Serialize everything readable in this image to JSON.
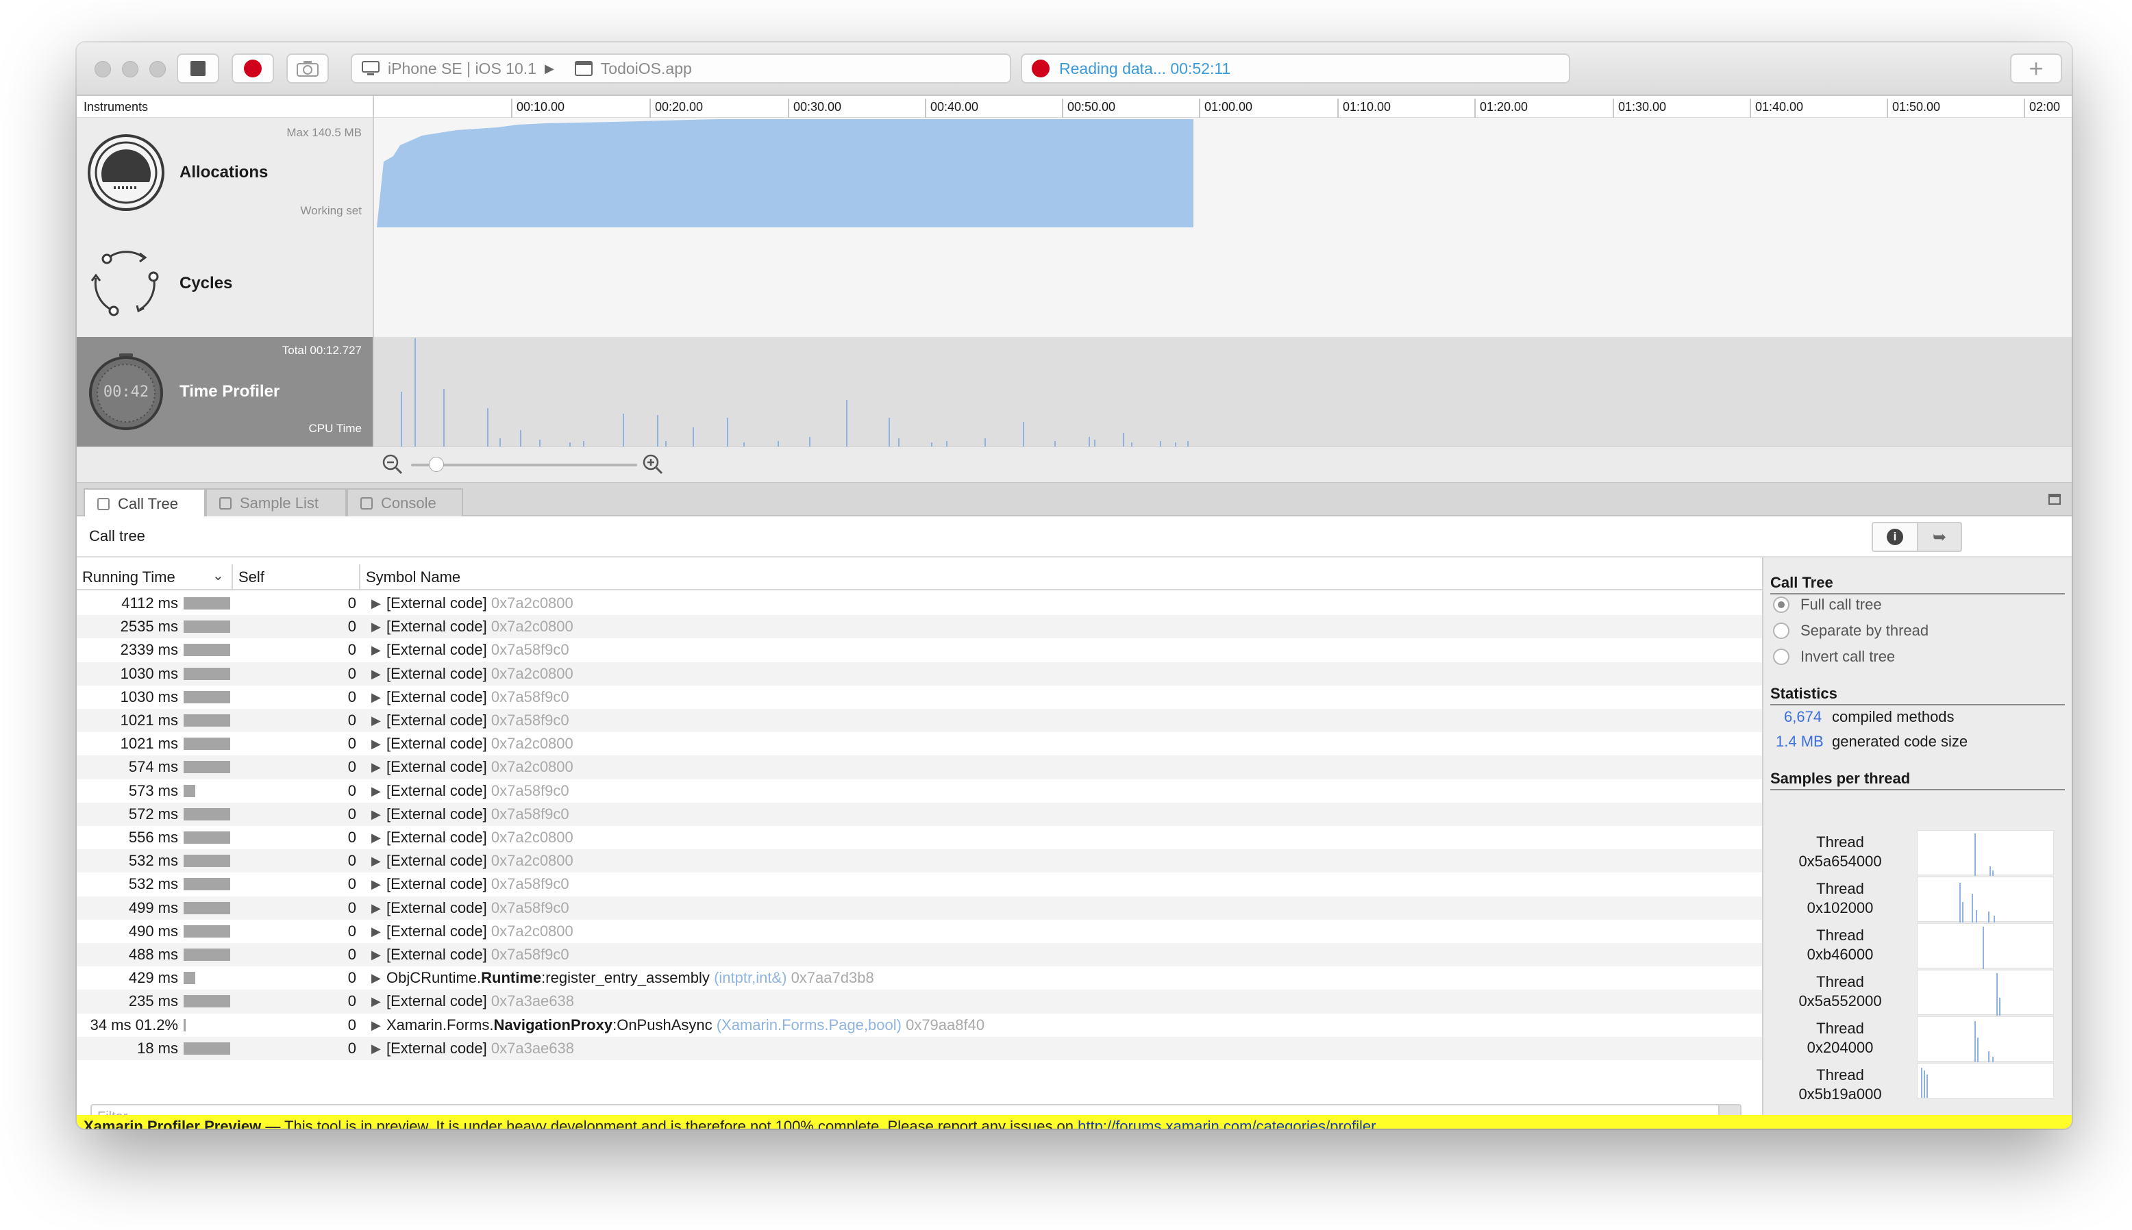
{
  "toolbar": {
    "device_label": "iPhone SE | iOS 10.1",
    "app_label": "TodoiOS.app",
    "status_text": "Reading data... 00:52:11",
    "add_label": "+"
  },
  "instruments": {
    "header": "Instruments",
    "timeline_ticks": [
      "00:10.00",
      "00:20.00",
      "00:30.00",
      "00:40.00",
      "00:50.00",
      "01:00.00",
      "01:10.00",
      "01:20.00",
      "01:30.00",
      "01:40.00",
      "01:50.00",
      "02:00"
    ],
    "tracks": [
      {
        "name": "Allocations",
        "top_text": "Max 140.5 MB",
        "bottom_text": "Working set"
      },
      {
        "name": "Cycles",
        "top_text": "",
        "bottom_text": ""
      },
      {
        "name": "Time Profiler",
        "top_text": "Total 00:12.727",
        "bottom_text": "CPU Time",
        "clock_text": "00:42"
      }
    ]
  },
  "tabs": [
    {
      "label": "Call Tree",
      "active": true
    },
    {
      "label": "Sample List",
      "active": false
    },
    {
      "label": "Console",
      "active": false
    }
  ],
  "calltree": {
    "title": "Call tree",
    "columns": {
      "running_time": "Running Time",
      "self": "Self",
      "symbol": "Symbol Name"
    },
    "rows": [
      {
        "time": "4112 ms",
        "bar": 1.0,
        "self": "0",
        "symbol": "[External code]",
        "addr": "0x7a2c0800"
      },
      {
        "time": "2535 ms",
        "bar": 1.0,
        "self": "0",
        "symbol": "[External code]",
        "addr": "0x7a2c0800"
      },
      {
        "time": "2339 ms",
        "bar": 1.0,
        "self": "0",
        "symbol": "[External code]",
        "addr": "0x7a58f9c0"
      },
      {
        "time": "1030 ms",
        "bar": 1.0,
        "self": "0",
        "symbol": "[External code]",
        "addr": "0x7a2c0800"
      },
      {
        "time": "1030 ms",
        "bar": 1.0,
        "self": "0",
        "symbol": "[External code]",
        "addr": "0x7a58f9c0"
      },
      {
        "time": "1021 ms",
        "bar": 1.0,
        "self": "0",
        "symbol": "[External code]",
        "addr": "0x7a58f9c0"
      },
      {
        "time": "1021 ms",
        "bar": 1.0,
        "self": "0",
        "symbol": "[External code]",
        "addr": "0x7a2c0800"
      },
      {
        "time": "574 ms",
        "bar": 1.0,
        "self": "0",
        "symbol": "[External code]",
        "addr": "0x7a2c0800"
      },
      {
        "time": "573 ms",
        "bar": 0.25,
        "self": "0",
        "symbol": "[External code]",
        "addr": "0x7a58f9c0"
      },
      {
        "time": "572 ms",
        "bar": 1.0,
        "self": "0",
        "symbol": "[External code]",
        "addr": "0x7a58f9c0"
      },
      {
        "time": "556 ms",
        "bar": 1.0,
        "self": "0",
        "symbol": "[External code]",
        "addr": "0x7a2c0800"
      },
      {
        "time": "532 ms",
        "bar": 1.0,
        "self": "0",
        "symbol": "[External code]",
        "addr": "0x7a2c0800"
      },
      {
        "time": "532 ms",
        "bar": 1.0,
        "self": "0",
        "symbol": "[External code]",
        "addr": "0x7a58f9c0"
      },
      {
        "time": "499 ms",
        "bar": 1.0,
        "self": "0",
        "symbol": "[External code]",
        "addr": "0x7a58f9c0"
      },
      {
        "time": "490 ms",
        "bar": 1.0,
        "self": "0",
        "symbol": "[External code]",
        "addr": "0x7a2c0800"
      },
      {
        "time": "488 ms",
        "bar": 1.0,
        "self": "0",
        "symbol": "[External code]",
        "addr": "0x7a58f9c0"
      },
      {
        "time": "429 ms",
        "bar": 0.25,
        "self": "0",
        "symbol_prefix": "ObjCRuntime.",
        "symbol_bold": "Runtime",
        "symbol_rest": ":register_entry_assembly",
        "sig": "(intptr,int&)",
        "addr": "0x7aa7d3b8"
      },
      {
        "time": "235 ms",
        "bar": 1.0,
        "self": "0",
        "symbol": "[External code]",
        "addr": "0x7a3ae638"
      },
      {
        "time": "34 ms 01.2%",
        "bar": 0.03,
        "self": "0",
        "symbol_prefix": "Xamarin.Forms.",
        "symbol_bold": "NavigationProxy",
        "symbol_rest": ":OnPushAsync",
        "sig": "(Xamarin.Forms.Page,bool)",
        "addr": "0x79aa8f40"
      },
      {
        "time": "18 ms",
        "bar": 1.0,
        "self": "0",
        "symbol": "[External code]",
        "addr": "0x7a3ae638"
      }
    ],
    "filter_placeholder": "Filter"
  },
  "side_panel": {
    "call_tree_heading": "Call Tree",
    "options": [
      {
        "label": "Full call tree",
        "selected": true
      },
      {
        "label": "Separate by thread",
        "selected": false
      },
      {
        "label": "Invert call tree",
        "selected": false
      }
    ],
    "statistics_heading": "Statistics",
    "stats": [
      {
        "value": "6,674",
        "label": "compiled methods"
      },
      {
        "value": "1.4 MB",
        "label": "generated code size"
      }
    ],
    "samples_heading": "Samples per thread",
    "threads": [
      {
        "label": "Thread",
        "id": "0x5a654000"
      },
      {
        "label": "Thread",
        "id": "0x102000"
      },
      {
        "label": "Thread",
        "id": "0xb46000"
      },
      {
        "label": "Thread",
        "id": "0x5a552000"
      },
      {
        "label": "Thread",
        "id": "0x204000"
      },
      {
        "label": "Thread",
        "id": "0x5b19a000"
      }
    ]
  },
  "banner": {
    "title": "Xamarin Profiler Preview",
    "text": " — This tool is in preview. It is under heavy development and is therefore not 100% complete. Please report any issues on ",
    "link": "http://forums.xamarin.com/categories/profiler"
  },
  "colors": {
    "accent": "#a4c6ea",
    "record": "#d0021b",
    "status_text": "#3b9ad9",
    "banner": "#fffe28"
  }
}
